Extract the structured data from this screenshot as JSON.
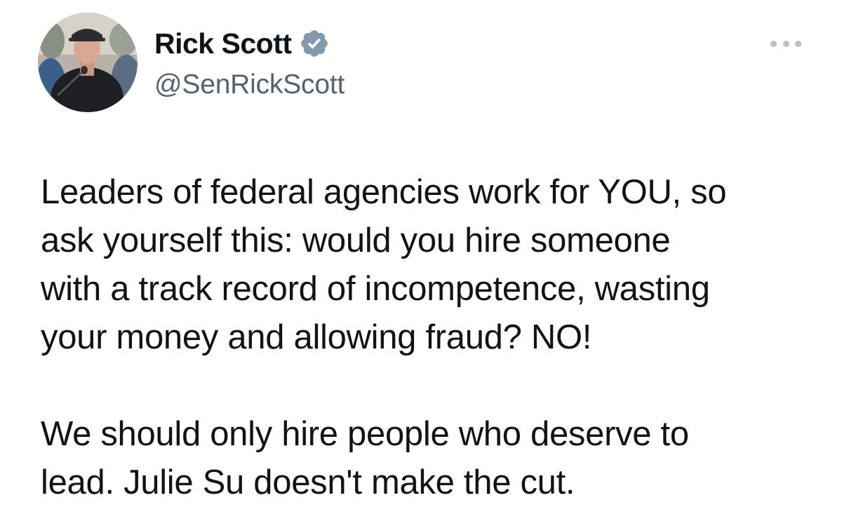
{
  "author": {
    "display_name": "Rick Scott",
    "handle": "@SenRickScott",
    "verified": true,
    "avatar": "profile-photo"
  },
  "colors": {
    "text": "#0f1419",
    "secondary": "#536471",
    "verified_badge": "#829aab",
    "more_dots": "#b9c0c6"
  },
  "icons": {
    "verified": "verified-badge-icon",
    "more": "more-options-icon"
  },
  "tweet": {
    "paragraphs": [
      {
        "lines": [
          "Leaders of federal agencies work for YOU, so",
          "ask yourself this: would you hire someone",
          "with a track record of incompetence, wasting",
          "your money and allowing fraud? NO!"
        ]
      },
      {
        "lines": [
          "We should only hire people who deserve to",
          "lead. Julie Su doesn't make the cut."
        ]
      }
    ]
  }
}
